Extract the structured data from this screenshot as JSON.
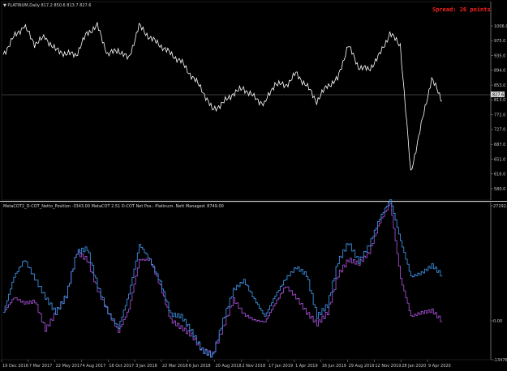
{
  "main_title": "▼ PLATINUM,Daily  817.2 850.6 813.7 827.6",
  "spread_label": "Spread: 26 points",
  "current_price_label": "827.6",
  "indicator_title": "MetaCOT2_D-COT_Netto_Position -3343.00   MetaCOT 2.51 D-COT Net Pos.: Platinum. Nett Managed: 8749.00",
  "colors": {
    "background": "#000000",
    "price_line": "#ffffff",
    "series_1": "#3c8de0",
    "series_2": "#a04cd0",
    "spread": "#ff2020",
    "separator": "#d0d0d0"
  },
  "x_tick_labels": [
    "19 Dec 2016",
    "7 Mar 2017",
    "22 May 2017",
    "4 Aug 2017",
    "18 Oct 2017",
    "3 Jan 2018",
    "22 Mar 2018",
    "6 Jun 2018",
    "20 Aug 2018",
    "2 Nov 2018",
    "17 Jan 2019",
    "1 Apr 2019",
    "16 Jun 2019",
    "29 Aug 2019",
    "12 Nov 2019",
    "28 Jan 2020",
    "9 Apr 2020"
  ],
  "chart_data": [
    {
      "type": "line",
      "series": [
        {
          "name": "PLATINUM,Daily",
          "x": [
            "2016-12",
            "2017-01",
            "2017-02",
            "2017-03",
            "2017-04",
            "2017-05",
            "2017-06",
            "2017-07",
            "2017-08",
            "2017-09",
            "2017-10",
            "2017-11",
            "2017-12",
            "2018-01",
            "2018-02",
            "2018-03",
            "2018-04",
            "2018-05",
            "2018-06",
            "2018-07",
            "2018-08",
            "2018-09",
            "2018-10",
            "2018-11",
            "2018-12",
            "2019-01",
            "2019-02",
            "2019-03",
            "2019-04",
            "2019-05",
            "2019-06",
            "2019-07",
            "2019-08",
            "2019-09",
            "2019-10",
            "2019-11",
            "2019-12",
            "2020-01",
            "2020-02",
            "2020-03",
            "2020-04",
            "2020-05",
            "2020-06"
          ],
          "values": [
            930,
            975,
            1005,
            958,
            975,
            942,
            932,
            930,
            985,
            1005,
            930,
            942,
            918,
            1005,
            975,
            955,
            932,
            912,
            875,
            840,
            785,
            802,
            828,
            842,
            818,
            800,
            855,
            848,
            880,
            850,
            808,
            848,
            865,
            955,
            898,
            890,
            928,
            985,
            955,
            620,
            745,
            868,
            808
          ]
        }
      ],
      "y_tick_labels": [
        "1006.0",
        "975.0",
        "935.0",
        "894.0",
        "853.0",
        "813.0",
        "772.0",
        "727.0",
        "687.0",
        "651.0",
        "616.0",
        "580.0"
      ],
      "ylim": [
        560,
        1030
      ]
    },
    {
      "type": "line",
      "series": [
        {
          "values": [
            -900,
            8500,
            13000,
            8000,
            3000,
            -1000,
            3500,
            15000,
            16000,
            6000,
            -1000,
            -5000,
            4000,
            17000,
            13000,
            7000,
            -1500,
            -2000,
            -6000,
            -11000,
            -12500,
            -3000,
            5000,
            7500,
            2500,
            -2000,
            3500,
            8000,
            11000,
            9000,
            -2000,
            1000,
            12500,
            17500,
            12500,
            17000,
            24000,
            29000,
            18000,
            8500,
            9500,
            11500,
            8749
          ]
        },
        {
          "values": [
            -900,
            3000,
            1500,
            2000,
            -5500,
            -1000,
            3500,
            15000,
            13000,
            5000,
            -1000,
            -6000,
            0,
            13000,
            13000,
            6000,
            -3000,
            -5000,
            -7000,
            -11000,
            -12000,
            -5000,
            2500,
            -1500,
            -3000,
            -3500,
            1500,
            6000,
            3000,
            -1000,
            -4000,
            -1000,
            9000,
            13000,
            12000,
            15000,
            23000,
            28000,
            8000,
            -2000,
            -1000,
            -500,
            -3343
          ]
        }
      ],
      "y_tick_labels": [
        "27292.00",
        "0.00",
        "-13476.00"
      ],
      "ylim": [
        -13476,
        27292
      ]
    }
  ]
}
